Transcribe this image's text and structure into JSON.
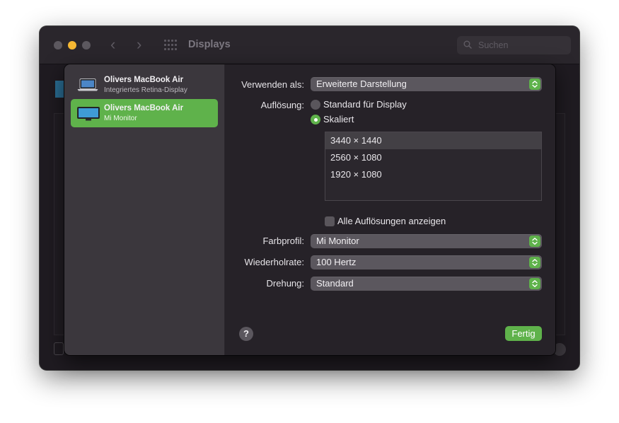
{
  "window": {
    "title": "Displays",
    "search_placeholder": "Suchen"
  },
  "sidebar": {
    "displays": [
      {
        "name": "Olivers MacBook Air",
        "subtitle": "Integriertes Retina-Display",
        "selected": false
      },
      {
        "name": "Olivers MacBook Air",
        "subtitle": "Mi Monitor",
        "selected": true
      }
    ]
  },
  "settings": {
    "use_as_label": "Verwenden als:",
    "use_as_value": "Erweiterte Darstellung",
    "resolution_label": "Auflösung:",
    "resolution_options": [
      "Standard für Display",
      "Skaliert"
    ],
    "resolution_selected": "Skaliert",
    "resolutions": [
      "3440 × 1440",
      "2560 × 1080",
      "1920 × 1080"
    ],
    "resolution_list_selected": "3440 × 1440",
    "show_all_label": "Alle Auflösungen anzeigen",
    "color_profile_label": "Farbprofil:",
    "color_profile_value": "Mi Monitor",
    "refresh_label": "Wiederholrate:",
    "refresh_value": "100 Hertz",
    "rotation_label": "Drehung:",
    "rotation_value": "Standard"
  },
  "buttons": {
    "help": "?",
    "done": "Fertig"
  },
  "colors": {
    "accent": "#5fb24b",
    "close_inactive": "#5c585f",
    "minimize": "#f5b733"
  }
}
